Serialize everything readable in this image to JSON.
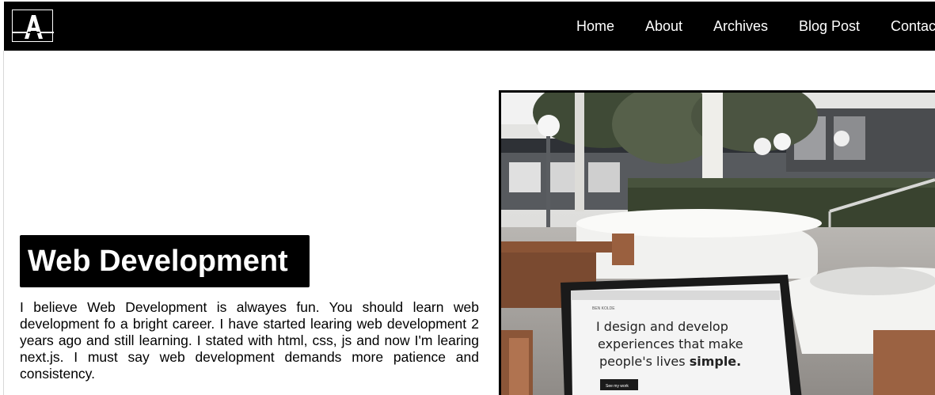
{
  "navbar": {
    "logo_letter": "A",
    "links": [
      {
        "label": "Home"
      },
      {
        "label": "About"
      },
      {
        "label": "Archives"
      },
      {
        "label": "Blog Post"
      },
      {
        "label": "Contact"
      }
    ]
  },
  "hero": {
    "title": "Web Development",
    "body": "I believe Web Development is alwayes fun. You should learn web development fo a bright career. I have started learing web development 2 years ago and still learning. I stated with html, css, js and now I'm learing next.js. I must say web development demands more patience and consistency."
  },
  "photo": {
    "laptop_screen_brand": "BEN KOLDE",
    "laptop_screen_line1": "I design and develop",
    "laptop_screen_line2": "experiences that make",
    "laptop_screen_line3_prefix": "people's lives ",
    "laptop_screen_line3_bold": "simple.",
    "laptop_screen_button": "See my work"
  }
}
